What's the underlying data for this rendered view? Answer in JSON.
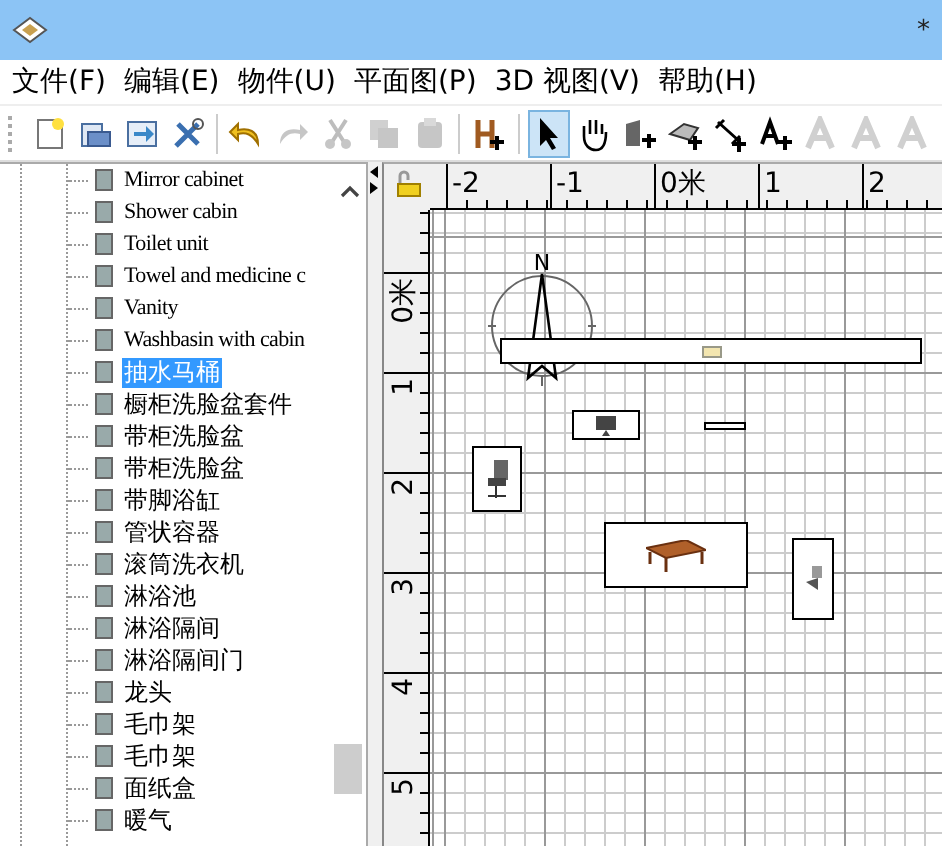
{
  "window": {
    "title": "*"
  },
  "menu": [
    "文件(F)",
    "编辑(E)",
    "物件(U)",
    "平面图(P)",
    "3D 视图(V)",
    "帮助(H)"
  ],
  "toolbar": [
    {
      "kind": "new",
      "disabled": false,
      "selected": false
    },
    {
      "kind": "open",
      "disabled": false,
      "selected": false
    },
    {
      "kind": "save",
      "disabled": false,
      "selected": false
    },
    {
      "kind": "tools",
      "disabled": false,
      "selected": false
    },
    {
      "kind": "sep"
    },
    {
      "kind": "undo",
      "disabled": false,
      "selected": false
    },
    {
      "kind": "redo",
      "disabled": true,
      "selected": false
    },
    {
      "kind": "cut",
      "disabled": true,
      "selected": false
    },
    {
      "kind": "copy",
      "disabled": true,
      "selected": false
    },
    {
      "kind": "paste",
      "disabled": true,
      "selected": false
    },
    {
      "kind": "sep"
    },
    {
      "kind": "add-furniture",
      "disabled": false,
      "selected": false
    },
    {
      "kind": "sep"
    },
    {
      "kind": "select",
      "disabled": false,
      "selected": true
    },
    {
      "kind": "pan",
      "disabled": false,
      "selected": false
    },
    {
      "kind": "walls",
      "disabled": false,
      "selected": false
    },
    {
      "kind": "rooms",
      "disabled": false,
      "selected": false
    },
    {
      "kind": "dimensions",
      "disabled": false,
      "selected": false
    },
    {
      "kind": "text",
      "disabled": false,
      "selected": false
    },
    {
      "kind": "text-style",
      "disabled": true,
      "selected": false
    },
    {
      "kind": "text-style",
      "disabled": true,
      "selected": false
    },
    {
      "kind": "text-style",
      "disabled": true,
      "selected": false
    }
  ],
  "catalog": [
    {
      "label": "Mirror cabinet",
      "selected": false
    },
    {
      "label": "Shower cabin",
      "selected": false
    },
    {
      "label": "Toilet unit",
      "selected": false
    },
    {
      "label": "Towel and medicine c",
      "selected": false
    },
    {
      "label": "Vanity",
      "selected": false
    },
    {
      "label": "Washbasin with cabin",
      "selected": false
    },
    {
      "label": "抽水马桶",
      "selected": true
    },
    {
      "label": "橱柜洗脸盆套件",
      "selected": false
    },
    {
      "label": "带柜洗脸盆",
      "selected": false
    },
    {
      "label": "带柜洗脸盆",
      "selected": false
    },
    {
      "label": "带脚浴缸",
      "selected": false
    },
    {
      "label": "管状容器",
      "selected": false
    },
    {
      "label": "滚筒洗衣机",
      "selected": false
    },
    {
      "label": "淋浴池",
      "selected": false
    },
    {
      "label": "淋浴隔间",
      "selected": false
    },
    {
      "label": "淋浴隔间门",
      "selected": false
    },
    {
      "label": "龙头",
      "selected": false
    },
    {
      "label": "毛巾架",
      "selected": false
    },
    {
      "label": "毛巾架",
      "selected": false
    },
    {
      "label": "面纸盒",
      "selected": false
    },
    {
      "label": "暖气",
      "selected": false
    }
  ],
  "plan": {
    "x_ruler": [
      "-2",
      "-1",
      "0米",
      "1",
      "2"
    ],
    "y_ruler": [
      "0米",
      "1",
      "2",
      "3",
      "4",
      "5"
    ],
    "compass_label": "N"
  }
}
